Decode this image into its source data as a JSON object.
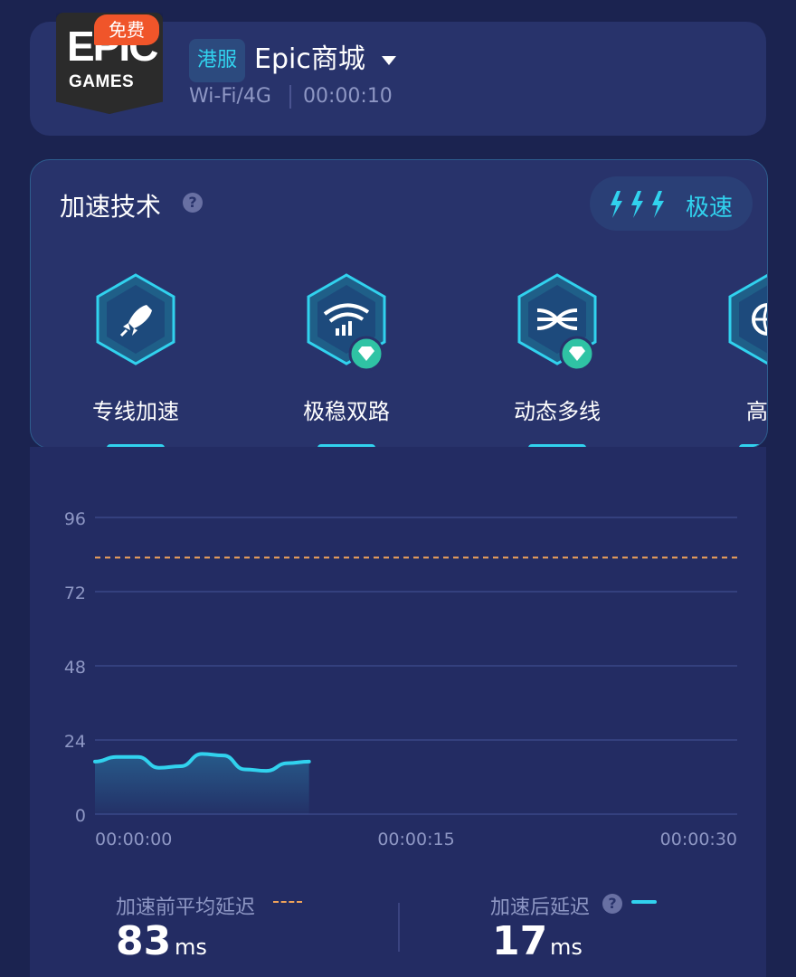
{
  "header": {
    "logo_text": "EPIC",
    "logo_subtext": "GAMES",
    "free_badge": "免费",
    "region_tag": "港服",
    "game_name": "Epic商城",
    "network": "Wi-Fi/4G",
    "elapsed": "00:00:10"
  },
  "tech": {
    "title": "加速技术",
    "mode": "极速",
    "features": [
      {
        "label": "专线加速",
        "icon": "rocket-icon",
        "premium": false
      },
      {
        "label": "极稳双路",
        "icon": "wifi-signal-icon",
        "premium": true
      },
      {
        "label": "动态多线",
        "icon": "multi-line-icon",
        "premium": true
      },
      {
        "label": "高速",
        "icon": "globe-icon",
        "premium": false
      }
    ]
  },
  "colors": {
    "accent": "#31d2ee",
    "baseline": "#f0a35a",
    "badge": "#f0552a"
  },
  "chart_data": {
    "type": "line",
    "y_ticks": [
      "96",
      "72",
      "48",
      "24",
      "0"
    ],
    "ylim": [
      0,
      96
    ],
    "x_ticks": [
      "00:00:00",
      "00:00:15",
      "00:00:30"
    ],
    "xlim": [
      0,
      30
    ],
    "baseline": {
      "value": 83
    },
    "series": [
      {
        "x": [
          0,
          1,
          2,
          3,
          4,
          5,
          6,
          7,
          8,
          9,
          10
        ],
        "y": [
          17,
          18.5,
          18.5,
          15,
          15.5,
          19.5,
          19,
          14.5,
          14,
          16.5,
          17
        ]
      }
    ],
    "grid": true
  },
  "stats": {
    "before_label": "加速前平均延迟",
    "before_value": "83",
    "before_unit": "ms",
    "after_label": "加速后延迟",
    "after_value": "17",
    "after_unit": "ms"
  }
}
